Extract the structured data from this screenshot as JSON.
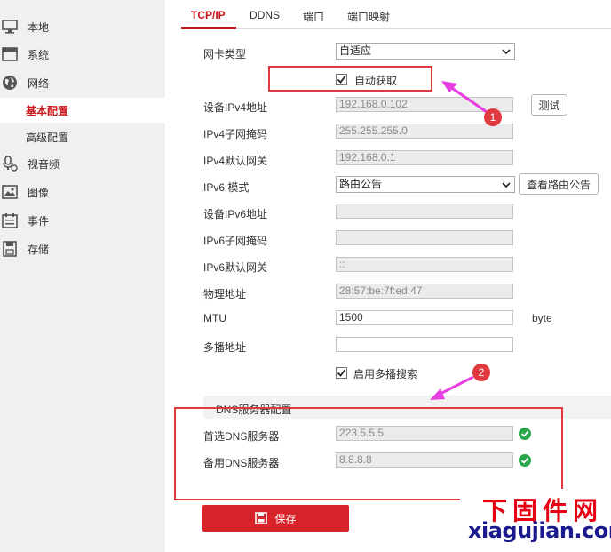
{
  "sidebar": {
    "items": [
      {
        "icon": "monitor-icon",
        "label": "本地"
      },
      {
        "icon": "system-icon",
        "label": "系统"
      },
      {
        "icon": "network-globe-icon",
        "label": "网络"
      },
      {
        "icon": "microphone-camera-icon",
        "label": "视音频"
      },
      {
        "icon": "image-icon",
        "label": "图像"
      },
      {
        "icon": "event-list-icon",
        "label": "事件"
      },
      {
        "icon": "storage-icon",
        "label": "存储"
      }
    ],
    "network_sub": [
      {
        "label": "基本配置",
        "active": true
      },
      {
        "label": "高级配置",
        "active": false
      }
    ]
  },
  "tabs": [
    {
      "label": "TCP/IP",
      "active": true
    },
    {
      "label": "DDNS",
      "active": false
    },
    {
      "label": "端口",
      "active": false
    },
    {
      "label": "端口映射",
      "active": false
    }
  ],
  "form": {
    "nic_type": {
      "label": "网卡类型",
      "value": "自适应"
    },
    "dhcp": {
      "label": "自动获取",
      "checked": true
    },
    "ipv4_addr": {
      "label": "设备IPv4地址",
      "value": "192.168.0.102"
    },
    "test_button": "测试",
    "ipv4_mask": {
      "label": "IPv4子网掩码",
      "value": "255.255.255.0"
    },
    "ipv4_gateway": {
      "label": "IPv4默认网关",
      "value": "192.168.0.1"
    },
    "ipv6_mode": {
      "label": "IPv6 模式",
      "value": "路由公告"
    },
    "view_route_button": "查看路由公告",
    "ipv6_addr": {
      "label": "设备IPv6地址",
      "value": ""
    },
    "ipv6_mask": {
      "label": "IPv6子网掩码",
      "value": ""
    },
    "ipv6_gateway": {
      "label": "IPv6默认网关",
      "value": "::"
    },
    "mac": {
      "label": "物理地址",
      "value": "28:57:be:7f:ed:47"
    },
    "mtu": {
      "label": "MTU",
      "value": "1500",
      "unit": "byte"
    },
    "multicast": {
      "label": "多播地址",
      "value": ""
    },
    "multicast_search": {
      "label": "启用多播搜索",
      "checked": true
    }
  },
  "dns": {
    "title": "DNS服务器配置",
    "preferred": {
      "label": "首选DNS服务器",
      "value": "223.5.5.5"
    },
    "alternate": {
      "label": "备用DNS服务器",
      "value": "8.8.8.8"
    }
  },
  "save_button": "保存",
  "annotations": {
    "badge1": "1",
    "badge2": "2"
  },
  "watermark": {
    "cn": "下固件网",
    "en": "xiagujian.com"
  },
  "colors": {
    "accent": "#c8161d",
    "save": "#d9232b",
    "annotation": "#e0393f",
    "arrow": "#e83de0",
    "ok": "#2aa64a"
  }
}
